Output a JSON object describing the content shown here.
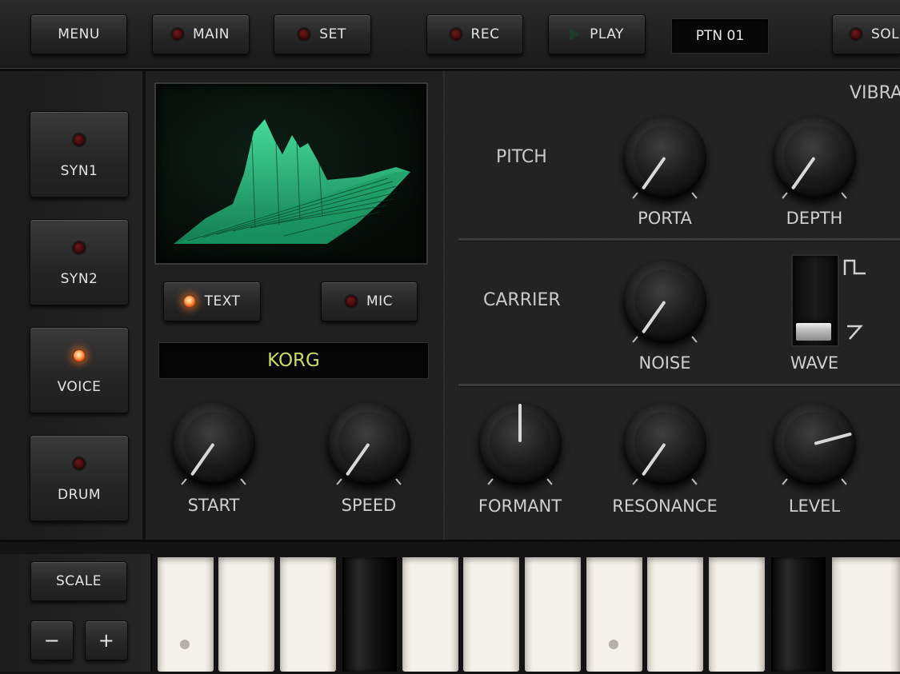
{
  "topbar": {
    "menu": "MENU",
    "main": "MAIN",
    "set": "SET",
    "rec": "REC",
    "play": "PLAY",
    "pattern": "PTN 01",
    "solo_partial": "SOL"
  },
  "modes": [
    {
      "label": "SYN1",
      "led": "off"
    },
    {
      "label": "SYN2",
      "led": "off"
    },
    {
      "label": "VOICE",
      "led": "on"
    },
    {
      "label": "DRUM",
      "led": "off"
    }
  ],
  "input": {
    "text_label": "TEXT",
    "text_led": "on",
    "mic_label": "MIC",
    "mic_led": "off",
    "text_value": "KORG"
  },
  "center_knobs": {
    "start": "START",
    "speed": "SPEED"
  },
  "vocoder": {
    "vibrato_partial": "VIBRA",
    "pitch_label": "PITCH",
    "porta": "PORTA",
    "depth": "DEPTH",
    "carrier_label": "CARRIER",
    "noise": "NOISE",
    "wave": "WAVE",
    "formant": "FORMANT",
    "resonance": "RESONANCE",
    "level": "LEVEL"
  },
  "scale": {
    "label": "SCALE",
    "minus": "−",
    "plus": "+"
  },
  "colors": {
    "led_on": "#ff7a30",
    "display_green": "#2fd08a",
    "text_display": "#c8dc6a"
  }
}
